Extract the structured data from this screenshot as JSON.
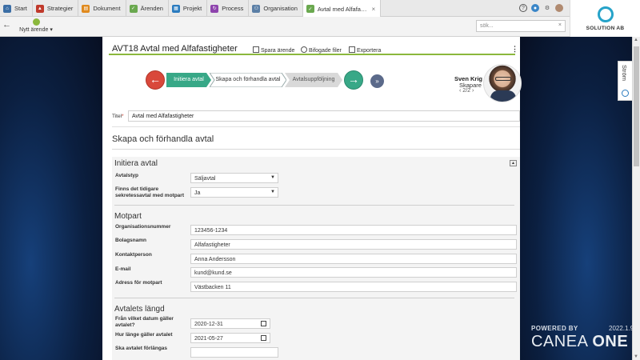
{
  "tabs": [
    {
      "label": "Start",
      "icon": "home-icon",
      "color": "#3b6ea5"
    },
    {
      "label": "Strategier",
      "icon": "strategy-icon",
      "color": "#c0392b"
    },
    {
      "label": "Dokument",
      "icon": "document-icon",
      "color": "#e08a1e"
    },
    {
      "label": "Ärenden",
      "icon": "case-icon",
      "color": "#6aa84f"
    },
    {
      "label": "Projekt",
      "icon": "project-icon",
      "color": "#2a7bbf"
    },
    {
      "label": "Process",
      "icon": "process-icon",
      "color": "#8e44ad"
    },
    {
      "label": "Organisation",
      "icon": "organisation-icon",
      "color": "#5b7fa6"
    },
    {
      "label": "Avtal med Alfafa…",
      "icon": "case-icon",
      "color": "#6aa84f",
      "active": true
    }
  ],
  "toolbar": {
    "new_case_label": "Nytt ärende",
    "search_placeholder": "sök..."
  },
  "logo": {
    "text": "SOLUTION AB"
  },
  "stream_label": "Ström",
  "branding": {
    "powered": "POWERED BY",
    "version": "2022.1.9",
    "brand_prefix": "CANEA ",
    "brand_suffix": "ONE"
  },
  "header": {
    "title": "AVT18 Avtal med Alfafastigheter",
    "save_label": "Spara ärende",
    "attach_label": "Bifogade filer",
    "export_label": "Exportera"
  },
  "workflow": {
    "steps": [
      {
        "label": "Initiera avtal",
        "state": "done"
      },
      {
        "label": "Skapa och förhandla avtal",
        "state": "current"
      },
      {
        "label": "Avtalsuppföljning",
        "state": "todo"
      }
    ]
  },
  "person": {
    "name": "Sven Krig",
    "role": "Skapare",
    "nav": "2/2"
  },
  "title_field": {
    "label": "Titel",
    "required_mark": "*",
    "value": "Avtal med Alfafastigheter"
  },
  "section_title": "Skapa och förhandla avtal",
  "groups": {
    "init": {
      "title": "Initiera avtal",
      "fields": [
        {
          "label": "Avtalstyp",
          "value": "Säljavtal"
        },
        {
          "label": "Finns det tidigare sekretessavtal med motpart",
          "value": "Ja"
        }
      ]
    },
    "motpart": {
      "title": "Motpart",
      "fields": [
        {
          "label": "Organisationsnummer",
          "value": "123456-1234"
        },
        {
          "label": "Bolagsnamn",
          "value": "Alfafastigheter"
        },
        {
          "label": "Kontaktperson",
          "value": "Anna Andersson"
        },
        {
          "label": "E-mail",
          "value": "kund@kund.se"
        },
        {
          "label": "Adress för motpart",
          "value": "Västbacken 11"
        }
      ]
    },
    "length": {
      "title": "Avtalets längd",
      "fields": [
        {
          "label": "Från vilket datum gäller avtalet?",
          "value": "2020-12-31"
        },
        {
          "label": "Hur länge gäller avtalet",
          "value": "2021-05-27"
        },
        {
          "label": "Ska avtalet förlängas",
          "value": ""
        }
      ]
    }
  }
}
